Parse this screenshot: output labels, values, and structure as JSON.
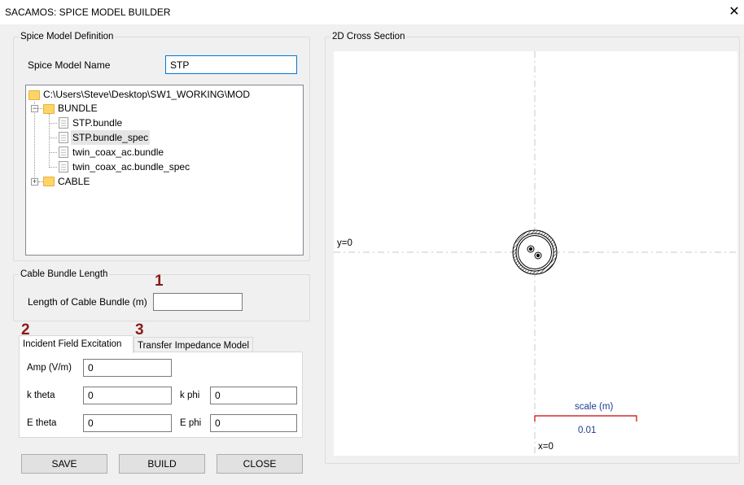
{
  "window": {
    "title": "SACAMOS: SPICE MODEL BUILDER",
    "close_glyph": "✕"
  },
  "model_definition": {
    "group_label": "Spice Model Definition",
    "name_label": "Spice Model Name",
    "name_value": "STP",
    "tree": {
      "root_path": "C:\\Users\\Steve\\Desktop\\SW1_WORKING\\MOD",
      "bundle_folder": "BUNDLE",
      "bundle_files": [
        "STP.bundle",
        "STP.bundle_spec",
        "twin_coax_ac.bundle",
        "twin_coax_ac.bundle_spec"
      ],
      "selected_file": "STP.bundle_spec",
      "cable_folder": "CABLE"
    }
  },
  "cable_bundle_length": {
    "group_label": "Cable Bundle Length",
    "length_label": "Length of Cable Bundle (m)",
    "length_value": ""
  },
  "callouts": [
    "1",
    "2",
    "3"
  ],
  "tabs": [
    {
      "label": "Incident Field Excitation",
      "active": true
    },
    {
      "label": "Transfer Impedance Model",
      "active": false
    }
  ],
  "excitation": {
    "amp_label": "Amp (V/m)",
    "amp_value": "0",
    "ktheta_label": "k theta",
    "ktheta_value": "0",
    "kphi_label": "k phi",
    "kphi_value": "0",
    "etheta_label": "E theta",
    "etheta_value": "0",
    "ephi_label": "E phi",
    "ephi_value": "0"
  },
  "buttons": {
    "save": "SAVE",
    "build": "BUILD",
    "close": "CLOSE"
  },
  "cross_section": {
    "group_label": "2D Cross Section",
    "y_axis_label": "y=0",
    "x_axis_label": "x=0",
    "scale_label": "scale (m)",
    "scale_value": "0.01",
    "scale_color": "#1f3a93",
    "scale_bar_color": "#cc0000"
  },
  "colors": {
    "accent": "#0078d7",
    "callout": "#8b1a1a",
    "folder": "#ffd467"
  },
  "icons": [
    "close-icon",
    "folder-icon",
    "file-icon",
    "expand-icon",
    "collapse-icon"
  ]
}
